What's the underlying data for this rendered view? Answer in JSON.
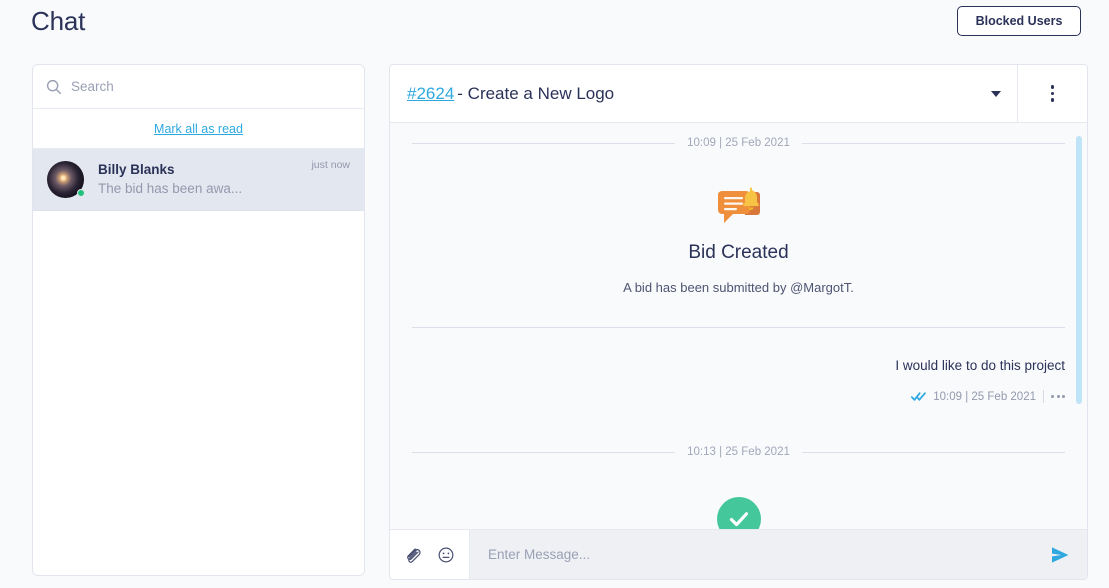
{
  "header": {
    "title": "Chat",
    "blocked_users_label": "Blocked Users"
  },
  "sidebar": {
    "search": {
      "placeholder": "Search",
      "value": "",
      "icon": "search-icon"
    },
    "mark_all_read_label": "Mark all as read",
    "conversations": [
      {
        "name": "Billy Blanks",
        "preview": "The bid has been awa...",
        "time": "just now",
        "online": true
      }
    ]
  },
  "chat": {
    "ticket_number": "#2624",
    "ticket_title": "- Create a New Logo",
    "caret_icon": "chevron-down-icon",
    "kebab_icon": "more-vertical-icon",
    "messages": [
      {
        "type": "day-divider",
        "label": "10:09 | 25 Feb 2021"
      },
      {
        "type": "system",
        "icon": "bid-created-icon",
        "title": "Bid Created",
        "subtitle": "A bid has been submitted by @MargotT."
      },
      {
        "type": "outgoing",
        "body": "I would like to do this project",
        "status_icon": "double-check-icon",
        "timestamp": "10:09 | 25 Feb 2021",
        "actions_icon": "more-horizontal-icon"
      },
      {
        "type": "day-divider",
        "label": "10:13 | 25 Feb 2021"
      },
      {
        "type": "status",
        "icon": "check-circle-icon"
      }
    ]
  },
  "composer": {
    "attach_icon": "paperclip-icon",
    "emoji_icon": "emoji-icon",
    "placeholder": "Enter Message...",
    "value": "",
    "send_icon": "send-icon"
  },
  "colors": {
    "accent_blue": "#2ea9e0",
    "navy": "#2b3258",
    "success_green": "#44c79b",
    "orange": "#ef8f3c",
    "gold": "#f6c344",
    "scrollbar": "#bfe4f7"
  }
}
